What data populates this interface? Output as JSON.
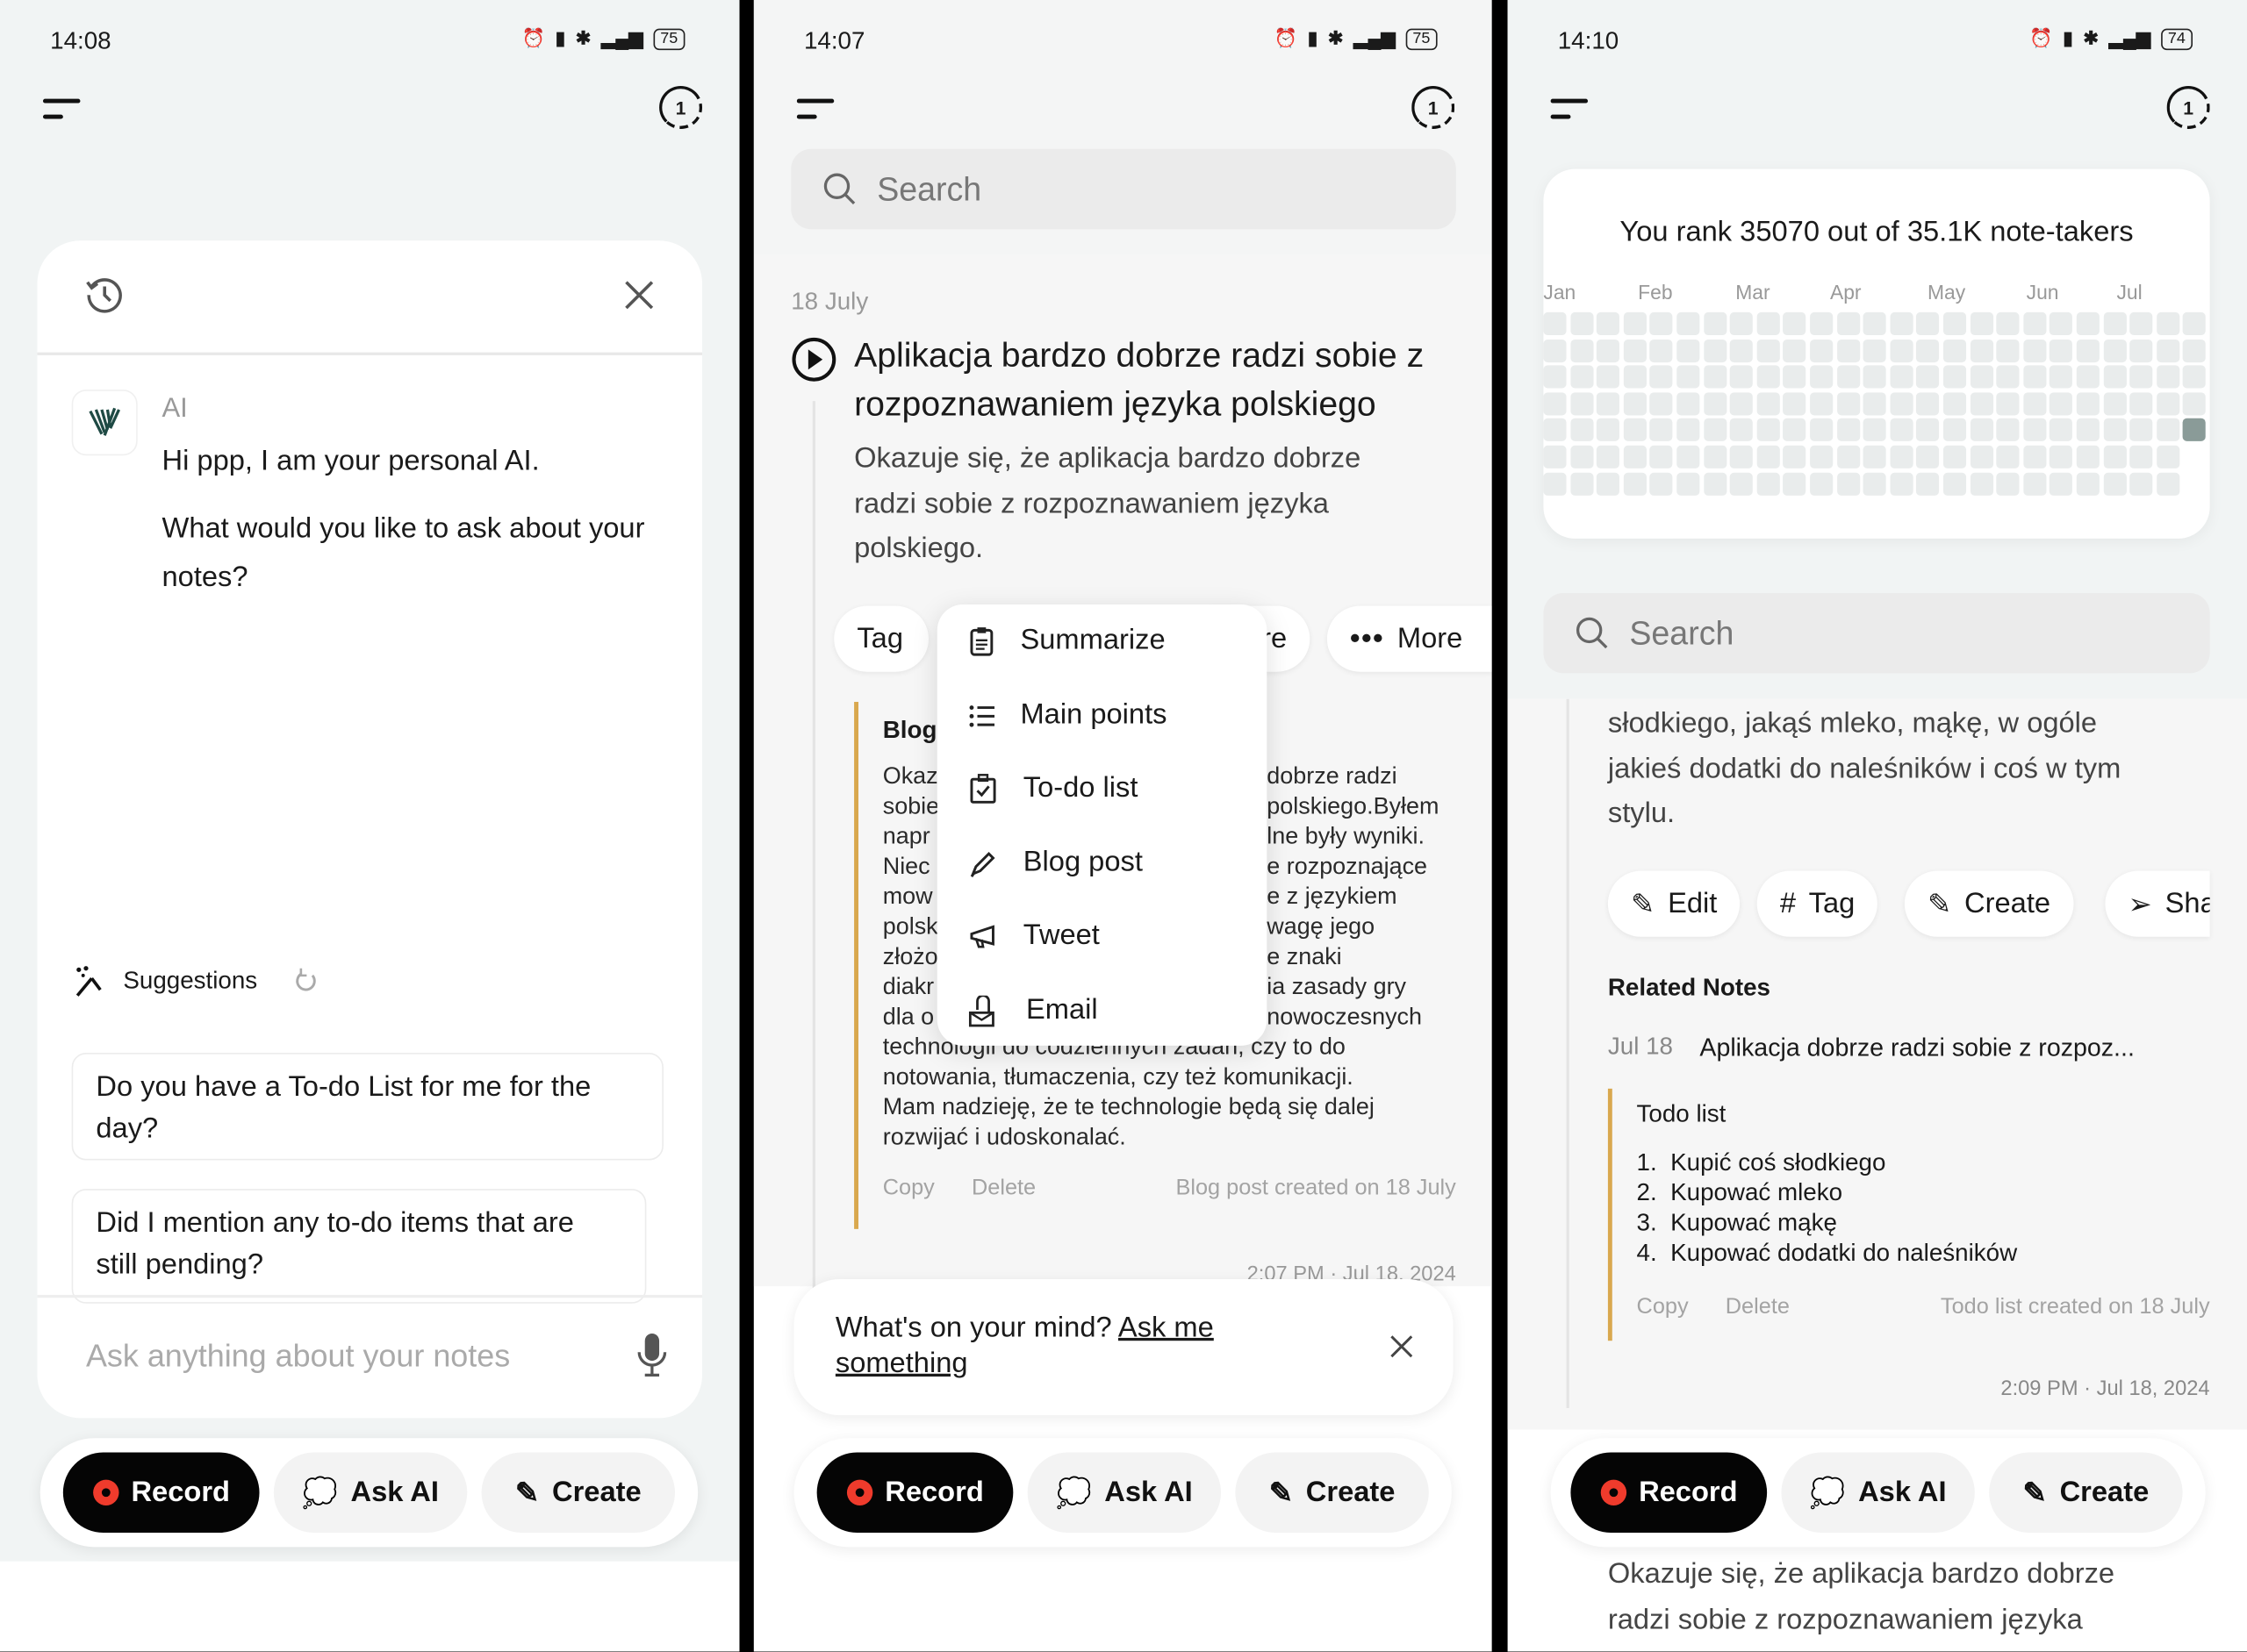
{
  "colors": {
    "accent_bar": "#d9a84e",
    "record_dot": "#ef3b2c",
    "heat_empty": "#e9ecec",
    "heat_active": "#8a9b98",
    "page_bg": "#f1f4f4"
  },
  "bottom_bar": {
    "record": "Record",
    "ask_ai": "Ask AI",
    "create": "Create",
    "icons": [
      "record-dot-icon",
      "chat-bubble-icon",
      "create-pen-icon"
    ]
  },
  "screen1": {
    "status": {
      "time": "14:08",
      "battery": "75"
    },
    "ai_label": "AI",
    "greeting": "Hi ppp, I am your personal AI.",
    "question": "What would you like to ask about your notes?",
    "suggestions_label": "Suggestions",
    "suggestions": [
      "Do you have a To-do List for me for the day?",
      "Did I mention any to-do items that are still pending?"
    ],
    "input_placeholder": "Ask anything about your notes"
  },
  "screen2": {
    "status": {
      "time": "14:07",
      "battery": "75"
    },
    "search_placeholder": "Search",
    "date": "18 July",
    "note_title": "Aplikacja bardzo dobrze radzi sobie z rozpoznawaniem języka polskiego",
    "note_body": "Okazuje się, że aplikacja bardzo dobrze radzi sobie z rozpoznawaniem języka polskiego.",
    "chips": {
      "tag": "Tag",
      "partial": "re",
      "more": "More"
    },
    "menu": [
      {
        "label": "Summarize",
        "icon": "clipboard-icon"
      },
      {
        "label": "Main points",
        "icon": "list-icon"
      },
      {
        "label": "To-do list",
        "icon": "checklist-icon"
      },
      {
        "label": "Blog post",
        "icon": "pen-icon"
      },
      {
        "label": "Tweet",
        "icon": "megaphone-icon"
      },
      {
        "label": "Email",
        "icon": "mail-icon"
      }
    ],
    "blog": {
      "title": "Blog",
      "split_lines": [
        [
          "Okaz",
          "dobrze radzi"
        ],
        [
          "sobie",
          "polskiego.Byłem"
        ],
        [
          "napr",
          "lne były wyniki."
        ],
        [
          "Niec",
          "e rozpoznające"
        ],
        [
          "mow",
          "e z językiem"
        ],
        [
          "polsk",
          "wagę jego"
        ],
        [
          "złożo",
          "e znaki"
        ],
        [
          "diakr",
          "ia zasady gry"
        ],
        [
          "dla o",
          "nowoczesnych"
        ]
      ],
      "full_lines": [
        "technologii do codziennych zadań, czy to do",
        "notowania, tłumaczenia, czy też komunikacji.",
        "Mam nadzieję, że te technologie będą się dalej",
        "rozwijać i udoskonalać."
      ],
      "copy": "Copy",
      "delete": "Delete",
      "created": "Blog post created on 18 July"
    },
    "timestamp": "2:07 PM · Jul 18, 2024",
    "prompt": {
      "text": "What's on your mind? ",
      "link": "Ask me something"
    }
  },
  "screen3": {
    "status": {
      "time": "14:10",
      "battery": "74"
    },
    "rank_text": "You rank 35070 out of 35.1K note-takers",
    "heatmap": {
      "months": [
        "Jan",
        "Feb",
        "Mar",
        "Apr",
        "May",
        "Jun",
        "Jul"
      ],
      "weeks": 25,
      "days": 7,
      "last_week_days": 5,
      "active_cells": [
        {
          "week": 24,
          "day": 4
        }
      ]
    },
    "search_placeholder": "Search",
    "body_lines": [
      "słodkiego, jakąś mleko, mąkę, w ogóle",
      "jakieś dodatki do naleśników i coś w tym",
      "stylu."
    ],
    "chips": {
      "edit": "Edit",
      "tag": "Tag",
      "create": "Create",
      "share": "Sha"
    },
    "related_title": "Related Notes",
    "related": {
      "date": "Jul 18",
      "title": "Aplikacja dobrze radzi sobie z rozpoz..."
    },
    "todo": {
      "title": "Todo list",
      "items": [
        "1.  Kupić coś słodkiego",
        "2.  Kupować mleko",
        "3.  Kupować mąkę",
        "4.  Kupować dodatki do naleśników"
      ],
      "copy": "Copy",
      "delete": "Delete",
      "created": "Todo list created on 18 July"
    },
    "timestamp": "2:09 PM · Jul 18, 2024",
    "below_lines": [
      "Okazuje się, że aplikacja bardzo dobrze",
      "radzi sobie z rozpoznawaniem języka"
    ]
  }
}
